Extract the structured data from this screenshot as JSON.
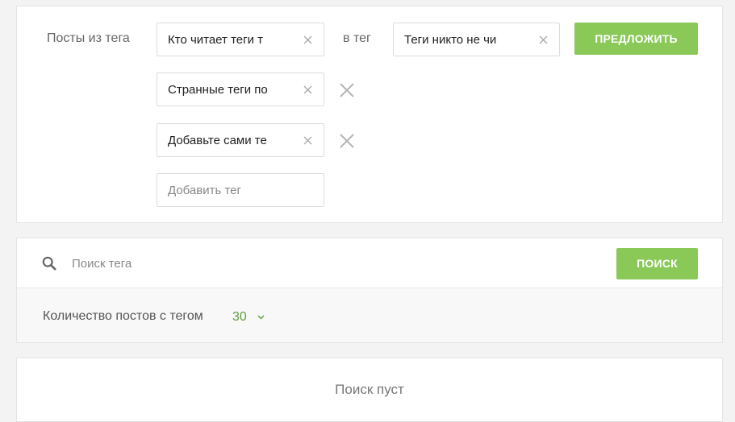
{
  "merge": {
    "from_label": "Посты из тега",
    "to_label": "в тег",
    "source_tags": [
      "Кто читает теги т",
      "Странные теги по",
      "Добавьте сами те"
    ],
    "add_tag_placeholder": "Добавить тег",
    "target_tag": "Теги никто не чи",
    "submit_label": "ПРЕДЛОЖИТЬ"
  },
  "search": {
    "placeholder": "Поиск тега",
    "button_label": "ПОИСК",
    "count_label": "Количество постов с тегом",
    "count_value": "30"
  },
  "results": {
    "empty_text": "Поиск пуст"
  },
  "colors": {
    "accent_green": "#8ac858",
    "count_green": "#5f9e3a"
  },
  "icons": {
    "clear": "close-icon",
    "remove_row": "close-icon-large",
    "search": "search-icon",
    "dropdown": "chevron-down-icon"
  }
}
